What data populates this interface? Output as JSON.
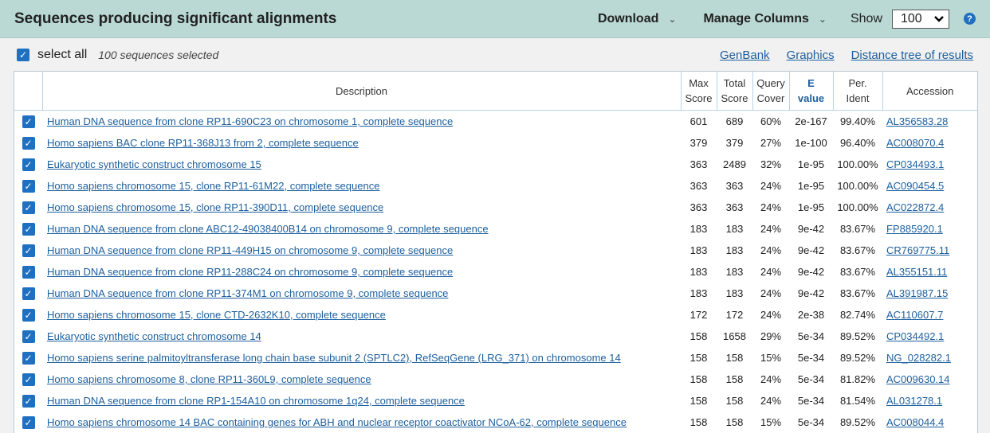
{
  "header": {
    "title": "Sequences producing significant alignments",
    "download_label": "Download",
    "manage_columns_label": "Manage Columns",
    "show_label": "Show",
    "show_value": "100",
    "help_icon": "question-circle-icon"
  },
  "toolbar": {
    "select_all_label": "select all",
    "selected_count": "100 sequences selected",
    "links": [
      "GenBank",
      "Graphics",
      "Distance tree of results"
    ]
  },
  "table": {
    "columns": {
      "description": "Description",
      "max_score_1": "Max",
      "max_score_2": "Score",
      "total_score_1": "Total",
      "total_score_2": "Score",
      "query_cover_1": "Query",
      "query_cover_2": "Cover",
      "evalue_1": "E",
      "evalue_2": "value",
      "per_ident_1": "Per.",
      "per_ident_2": "Ident",
      "accession": "Accession"
    },
    "rows": [
      {
        "description": "Human DNA sequence from clone RP11-690C23 on chromosome 1, complete sequence",
        "max": "601",
        "total": "689",
        "cover": "60%",
        "evalue": "2e-167",
        "ident": "99.40%",
        "accession": "AL356583.28"
      },
      {
        "description": "Homo sapiens BAC clone RP11-368J13 from 2, complete sequence",
        "max": "379",
        "total": "379",
        "cover": "27%",
        "evalue": "1e-100",
        "ident": "96.40%",
        "accession": "AC008070.4"
      },
      {
        "description": "Eukaryotic synthetic construct chromosome 15",
        "max": "363",
        "total": "2489",
        "cover": "32%",
        "evalue": "1e-95",
        "ident": "100.00%",
        "accession": "CP034493.1"
      },
      {
        "description": "Homo sapiens chromosome 15, clone RP11-61M22, complete sequence",
        "max": "363",
        "total": "363",
        "cover": "24%",
        "evalue": "1e-95",
        "ident": "100.00%",
        "accession": "AC090454.5"
      },
      {
        "description": "Homo sapiens chromosome 15, clone RP11-390D11, complete sequence",
        "max": "363",
        "total": "363",
        "cover": "24%",
        "evalue": "1e-95",
        "ident": "100.00%",
        "accession": "AC022872.4"
      },
      {
        "description": "Human DNA sequence from clone ABC12-49038400B14 on chromosome 9, complete sequence",
        "max": "183",
        "total": "183",
        "cover": "24%",
        "evalue": "9e-42",
        "ident": "83.67%",
        "accession": "FP885920.1"
      },
      {
        "description": "Human DNA sequence from clone RP11-449H15 on chromosome 9, complete sequence",
        "max": "183",
        "total": "183",
        "cover": "24%",
        "evalue": "9e-42",
        "ident": "83.67%",
        "accession": "CR769775.11"
      },
      {
        "description": "Human DNA sequence from clone RP11-288C24 on chromosome 9, complete sequence",
        "max": "183",
        "total": "183",
        "cover": "24%",
        "evalue": "9e-42",
        "ident": "83.67%",
        "accession": "AL355151.11"
      },
      {
        "description": "Human DNA sequence from clone RP11-374M1 on chromosome 9, complete sequence",
        "max": "183",
        "total": "183",
        "cover": "24%",
        "evalue": "9e-42",
        "ident": "83.67%",
        "accession": "AL391987.15"
      },
      {
        "description": "Homo sapiens chromosome 15, clone CTD-2632K10, complete sequence",
        "max": "172",
        "total": "172",
        "cover": "24%",
        "evalue": "2e-38",
        "ident": "82.74%",
        "accession": "AC110607.7"
      },
      {
        "description": "Eukaryotic synthetic construct chromosome 14",
        "max": "158",
        "total": "1658",
        "cover": "29%",
        "evalue": "5e-34",
        "ident": "89.52%",
        "accession": "CP034492.1"
      },
      {
        "description": "Homo sapiens serine palmitoyltransferase long chain base subunit 2 (SPTLC2), RefSeqGene (LRG_371) on chromosome 14",
        "max": "158",
        "total": "158",
        "cover": "15%",
        "evalue": "5e-34",
        "ident": "89.52%",
        "accession": "NG_028282.1"
      },
      {
        "description": "Homo sapiens chromosome 8, clone RP11-360L9, complete sequence",
        "max": "158",
        "total": "158",
        "cover": "24%",
        "evalue": "5e-34",
        "ident": "81.82%",
        "accession": "AC009630.14"
      },
      {
        "description": "Human DNA sequence from clone RP1-154A10 on chromosome 1q24, complete sequence",
        "max": "158",
        "total": "158",
        "cover": "24%",
        "evalue": "5e-34",
        "ident": "81.54%",
        "accession": "AL031278.1"
      },
      {
        "description": "Homo sapiens chromosome 14 BAC containing genes for ABH and nuclear receptor coactivator NCoA-62, complete sequence",
        "max": "158",
        "total": "158",
        "cover": "15%",
        "evalue": "5e-34",
        "ident": "89.52%",
        "accession": "AC008044.4"
      }
    ]
  }
}
